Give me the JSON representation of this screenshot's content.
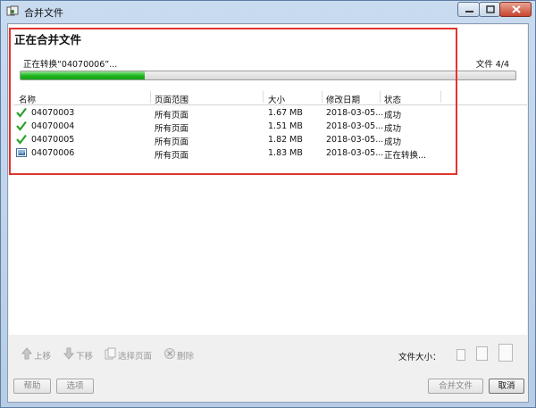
{
  "window": {
    "title": "合并文件"
  },
  "header": {
    "title": "正在合并文件"
  },
  "progress": {
    "label": "正在转换“04070006”...",
    "count": "文件 4/4",
    "fraction": 0.25
  },
  "table": {
    "columns": [
      "名称",
      "页面范围",
      "大小",
      "修改日期",
      "状态"
    ],
    "rows": [
      {
        "icon": "check-icon",
        "name": "04070003",
        "range": "所有页面",
        "size": "1.67 MB",
        "date": "2018-03-05...",
        "status": "成功"
      },
      {
        "icon": "check-icon",
        "name": "04070004",
        "range": "所有页面",
        "size": "1.51 MB",
        "date": "2018-03-05...",
        "status": "成功"
      },
      {
        "icon": "check-icon",
        "name": "04070005",
        "range": "所有页面",
        "size": "1.82 MB",
        "date": "2018-03-05...",
        "status": "成功"
      },
      {
        "icon": "image-file-icon",
        "name": "04070006",
        "range": "所有页面",
        "size": "1.83 MB",
        "date": "2018-03-05...",
        "status": "正在转换..."
      }
    ]
  },
  "toolbar": {
    "up": "上移",
    "down": "下移",
    "select_pages": "选择页面",
    "delete": "删除",
    "file_size": "文件大小："
  },
  "footer": {
    "help": "帮助",
    "options": "选项",
    "merge": "合并文件",
    "cancel": "取消"
  },
  "colors": {
    "highlight_border": "#e2342f",
    "progress_fill": "#1db51d"
  }
}
